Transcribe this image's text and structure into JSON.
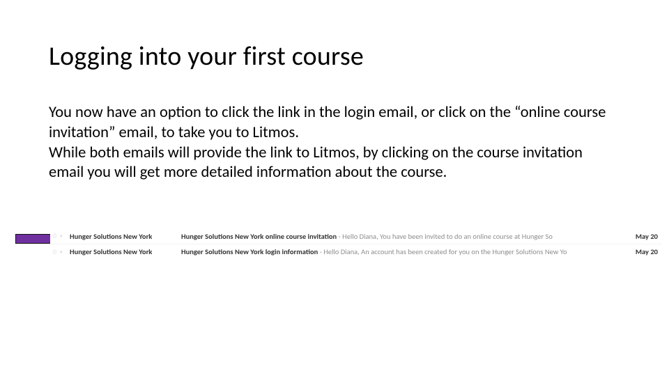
{
  "title": "Logging into your first course",
  "paragraph1": "You now have an option to click the link in the login email, or click on the “online course invitation” email, to take you to Litmos.",
  "paragraph2": "While both emails will provide the link to Litmos, by clicking on the course invitation email you will get more detailed information about the course.",
  "inbox": {
    "rows": [
      {
        "sender": "Hunger Solutions New York",
        "subject": "Hunger Solutions New York online course invitation",
        "preview": " - Hello Diana, You have been invited to do an online course at Hunger So",
        "date": "May 20"
      },
      {
        "sender": "Hunger Solutions New York",
        "subject": "Hunger Solutions New York login information",
        "preview": " - Hello Diana, An account has been created for you on the Hunger Solutions New Yo",
        "date": "May 20"
      }
    ]
  },
  "icons": {
    "star": "☆",
    "tag": "▫"
  }
}
